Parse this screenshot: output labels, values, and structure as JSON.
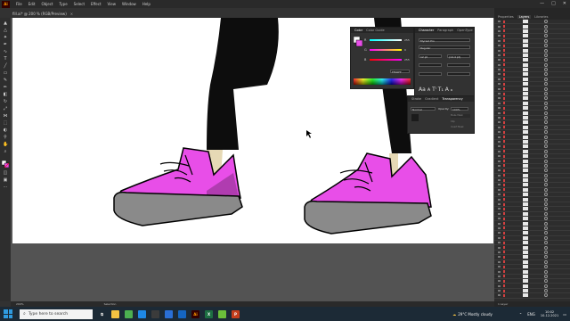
{
  "app": {
    "logo": "Ai",
    "menu": [
      "File",
      "Edit",
      "Object",
      "Type",
      "Select",
      "Effect",
      "View",
      "Window",
      "Help"
    ],
    "doc_tab": "fill.ai* @ 200 % (RGB/Preview)",
    "doc_tab_close": "×"
  },
  "window_controls": [
    "—",
    "□",
    "✕"
  ],
  "status": {
    "zoom": "200%",
    "tool": "Selection"
  },
  "panel_tabs": [
    "Properties",
    "Layers",
    "Libraries"
  ],
  "layers_footer": "1 Layer",
  "color_panel": {
    "tabs": [
      "Color",
      "Color Guide"
    ],
    "sliders": [
      {
        "label": "R",
        "value": "255",
        "gradient": "linear-gradient(to right,#00ffff,#ffffff)"
      },
      {
        "label": "G",
        "value": "0",
        "gradient": "linear-gradient(to right,#ff00ff,#ffff00)"
      },
      {
        "label": "B",
        "value": "255",
        "gradient": "linear-gradient(to right,#ff0000,#ff00ff)"
      }
    ],
    "hex": "FF00FF"
  },
  "char_panel": {
    "tabs": [
      "Character",
      "Paragraph",
      "OpenType"
    ],
    "font": "Myriad Pro",
    "style": "Regular",
    "size": "12 pt",
    "leading": "(14.4 pt)"
  },
  "transparency_panel": {
    "tabs": [
      "Stroke",
      "Gradient",
      "Transparency"
    ],
    "blend_mode": "Normal",
    "opacity_label": "Opacity:",
    "opacity": "100%",
    "buttons": [
      "Make Mask",
      "Clip",
      "Invert Mask"
    ]
  },
  "colors": {
    "shoe_pink": "#e84ee8",
    "shoe_shadow": "#b03cb0",
    "sole": "#8a8a8a",
    "sock": "#e6d9b5",
    "pants": "#0d0d0d"
  },
  "taskbar": {
    "search_placeholder": "Type here to search",
    "apps": [
      {
        "icon": "file-explorer-icon",
        "color": "#f5c342",
        "text": ""
      },
      {
        "icon": "chrome-icon",
        "color": "#4caf50",
        "text": ""
      },
      {
        "icon": "edge-icon",
        "color": "#1e88e5",
        "text": ""
      },
      {
        "icon": "store-icon",
        "color": "#3b3b3b",
        "text": ""
      },
      {
        "icon": "mail-icon",
        "color": "#2a6fd6",
        "text": ""
      },
      {
        "icon": "photos-icon",
        "color": "#1565c0",
        "text": ""
      },
      {
        "icon": "illustrator-icon",
        "color": "#330000",
        "text": "Ai"
      },
      {
        "icon": "excel-icon",
        "color": "#1d6f42",
        "text": "X"
      },
      {
        "icon": "game-icon",
        "color": "#6bbf3a",
        "text": ""
      },
      {
        "icon": "powerpoint-icon",
        "color": "#c43e1c",
        "text": "P"
      }
    ],
    "weather": "29°C  Mostly cloudy",
    "lang": "ENG",
    "time": "10:02",
    "date": "10-12-2021"
  }
}
